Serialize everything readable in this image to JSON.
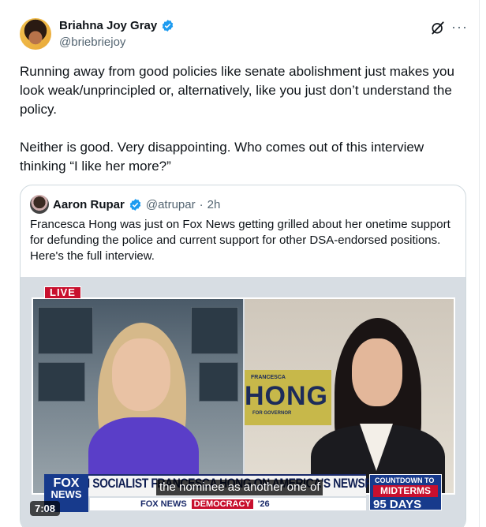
{
  "tweet": {
    "author": {
      "display_name": "Briahna Joy Gray",
      "handle": "@briebriejoy"
    },
    "text": [
      "Running away from good policies like senate abolishment just makes you look weak/unprincipled or, alternatively, like you just don’t understand the policy.",
      "Neither is good. Very disappointing. Who comes out of this interview thinking “I like her more?”"
    ],
    "icons": {
      "verified": "verified-badge-icon",
      "grok": "grok-icon",
      "more": "more-icon"
    },
    "colors": {
      "verified": "#1d9bf0",
      "secondary_text": "#536471"
    }
  },
  "quote": {
    "author": {
      "display_name": "Aaron Rupar",
      "handle": "@atrupar",
      "separator": "·",
      "time": "2h"
    },
    "text": "Francesca Hong was just on Fox News getting grilled about her onetime support for defunding the police and current support for other DSA-endorsed positions. Here's the full interview.",
    "video": {
      "live_badge": "LIVE",
      "headline": "DEM SOCIALIST FRANCESCA HONG ON AMERICA'S NEWSROOM",
      "caption": "the nominee as another one of",
      "logo_top": "FOX",
      "logo_bottom": "NEWS",
      "ticker_brand": "FOX NEWS",
      "ticker_demo": "DEMOCRACY",
      "ticker_year": "'26",
      "countdown_title": "COUNTDOWN TO THE",
      "countdown_label": "MIDTERMS",
      "countdown_days": "95 DAYS",
      "sign_top": "FRANCESCA",
      "sign_name": "HONG",
      "sign_sub": "FOR GOVERNOR",
      "duration": "7:08"
    }
  }
}
